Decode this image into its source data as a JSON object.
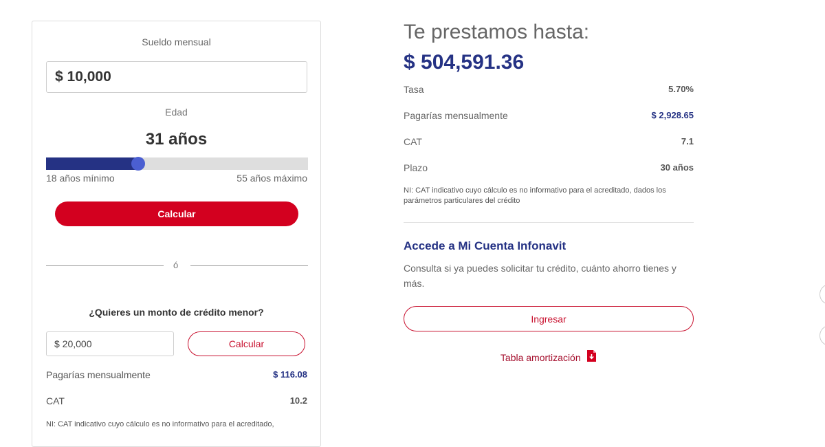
{
  "calculator": {
    "salary_label": "Sueldo mensual",
    "salary_value": "$ 10,000",
    "age_label": "Edad",
    "age_value": "31 años",
    "age_min_label": "18 años mínimo",
    "age_max_label": "55 años máximo",
    "age_min": 18,
    "age_max": 55,
    "age_current": 31,
    "calc_button": "Calcular",
    "divider_text": "ó",
    "smaller_question": "¿Quieres un monto de crédito menor?",
    "smaller_amount_value": "$ 20,000",
    "smaller_calc_button": "Calcular",
    "rows": [
      {
        "label": "Pagarías mensualmente",
        "value": "$ 116.08",
        "value_color": "#253284"
      },
      {
        "label": "CAT",
        "value": "10.2",
        "value_color": "#555555"
      }
    ],
    "note": "NI: CAT indicativo cuyo cálculo es no informativo para el acreditado,"
  },
  "result": {
    "headline": "Te prestamos hasta:",
    "amount": "$ 504,591.36",
    "rows": [
      {
        "label": "Tasa",
        "value": "5.70%"
      },
      {
        "label": "Pagarías mensualmente",
        "value": "$ 2,928.65"
      },
      {
        "label": "CAT",
        "value": "7.1"
      },
      {
        "label": "Plazo",
        "value": "30 años"
      }
    ],
    "note": "NI: CAT indicativo cuyo cálculo es no informativo para el acreditado, dados los parámetros particulares del crédito"
  },
  "account": {
    "title": "Accede a Mi Cuenta Infonavit",
    "description": "Consulta si ya puedes solicitar tu crédito, cuánto ahorro tienes y más.",
    "login_button": "Ingresar",
    "amortization_link": "Tabla amortización",
    "amortization_icon": "pdf-download-icon"
  },
  "colors": {
    "brand_red": "#d3001f",
    "outline_red": "#c8102e",
    "brand_blue": "#253284",
    "slider_knob": "#4b5fd1"
  }
}
